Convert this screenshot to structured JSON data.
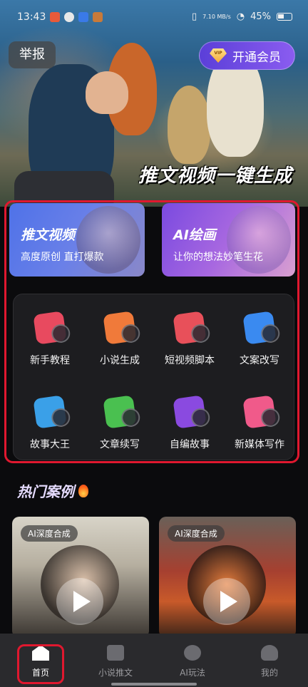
{
  "status_bar": {
    "time": "13:43",
    "network_speed": "7.10 MB/s",
    "battery": "45%"
  },
  "hero": {
    "report_label": "举报",
    "vip_badge": "VIP",
    "vip_label": "开通会员",
    "title": "推文视频一键生成"
  },
  "features": [
    {
      "title": "推文视频",
      "subtitle": "高度原创 直打爆款"
    },
    {
      "title": "AI绘画",
      "subtitle": "让你的想法妙笔生花"
    }
  ],
  "tools": [
    {
      "label": "新手教程",
      "icon": "question-book-icon",
      "color": "#e84a5f"
    },
    {
      "label": "小说生成",
      "icon": "novel-book-icon",
      "color": "#f07a3a"
    },
    {
      "label": "短视频脚本",
      "icon": "video-film-icon",
      "color": "#e8505a"
    },
    {
      "label": "文案改写",
      "icon": "text-rewrite-icon",
      "color": "#3a8af0"
    },
    {
      "label": "故事大王",
      "icon": "story-king-icon",
      "color": "#3aa0e8"
    },
    {
      "label": "文章续写",
      "icon": "article-continue-icon",
      "color": "#4ac050"
    },
    {
      "label": "自编故事",
      "icon": "crown-book-icon",
      "color": "#8a4ae0"
    },
    {
      "label": "新媒体写作",
      "icon": "media-write-icon",
      "color": "#f05a8a"
    }
  ],
  "hot_section": {
    "title": "热门案例"
  },
  "cases": [
    {
      "tag": "AI深度合成"
    },
    {
      "tag": "AI深度合成"
    }
  ],
  "tabbar": [
    {
      "label": "首页",
      "icon": "home-icon",
      "active": true
    },
    {
      "label": "小说推文",
      "icon": "video-book-icon",
      "active": false
    },
    {
      "label": "AI玩法",
      "icon": "planet-icon",
      "active": false
    },
    {
      "label": "我的",
      "icon": "profile-icon",
      "active": false
    }
  ]
}
